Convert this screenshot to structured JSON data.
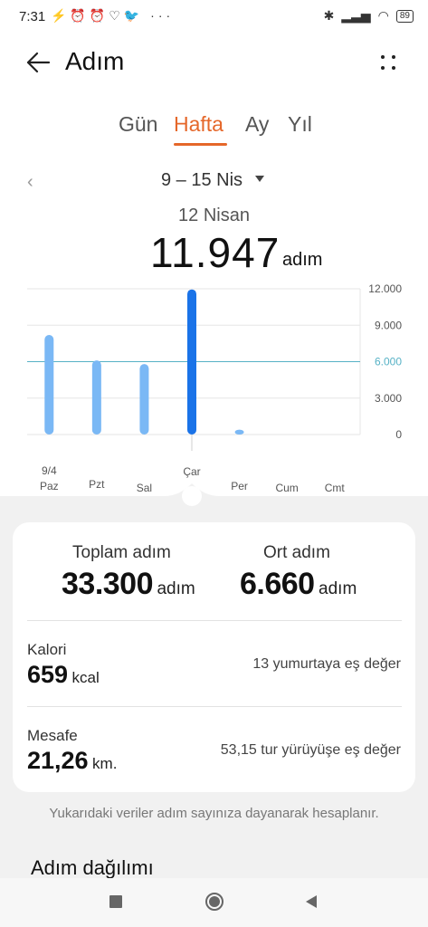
{
  "status_bar": {
    "time": "7:31",
    "icons": "⚡⏰⏰♡🐦 ···",
    "battery": "89"
  },
  "header": {
    "title": "Adım"
  },
  "tabs": [
    {
      "label": "Gün",
      "active": false
    },
    {
      "label": "Hafta",
      "active": true
    },
    {
      "label": "Ay",
      "active": false
    },
    {
      "label": "Yıl",
      "active": false
    }
  ],
  "week_nav": {
    "prev": "‹",
    "label": "9 – 15 Nis"
  },
  "selected": {
    "date": "12 Nisan",
    "value": "11.947",
    "unit": "adım"
  },
  "chart_data": {
    "type": "bar",
    "categories": [
      "Paz",
      "Pzt",
      "Sal",
      "Çar",
      "Per",
      "Cum",
      "Cmt"
    ],
    "category_dates": [
      "9/4",
      "",
      "",
      "",
      "",
      "",
      ""
    ],
    "values": [
      8200,
      6100,
      5800,
      11947,
      400,
      0,
      0
    ],
    "selected_index": 3,
    "ylim": [
      0,
      12000
    ],
    "yticks": [
      "12.000",
      "9.000",
      "6.000",
      "3.000",
      "0"
    ],
    "average": 6000,
    "average_label": "6.000",
    "colors": {
      "bar": "#7ab8f5",
      "selected": "#1a73e8",
      "average": "#57b2c6"
    }
  },
  "summary": {
    "total_label": "Toplam adım",
    "total_value": "33.300",
    "total_unit": "adım",
    "avg_label": "Ort adım",
    "avg_value": "6.660",
    "avg_unit": "adım",
    "calorie_label": "Kalori",
    "calorie_value": "659",
    "calorie_unit": "kcal",
    "calorie_eq": "13 yumurtaya eş değer",
    "distance_label": "Mesafe",
    "distance_value": "21,26",
    "distance_unit": "km.",
    "distance_eq": "53,15 tur yürüyüşe eş değer"
  },
  "note": "Yukarıdaki veriler adım sayınıza dayanarak hesaplanır.",
  "section_title": "Adım dağılımı"
}
